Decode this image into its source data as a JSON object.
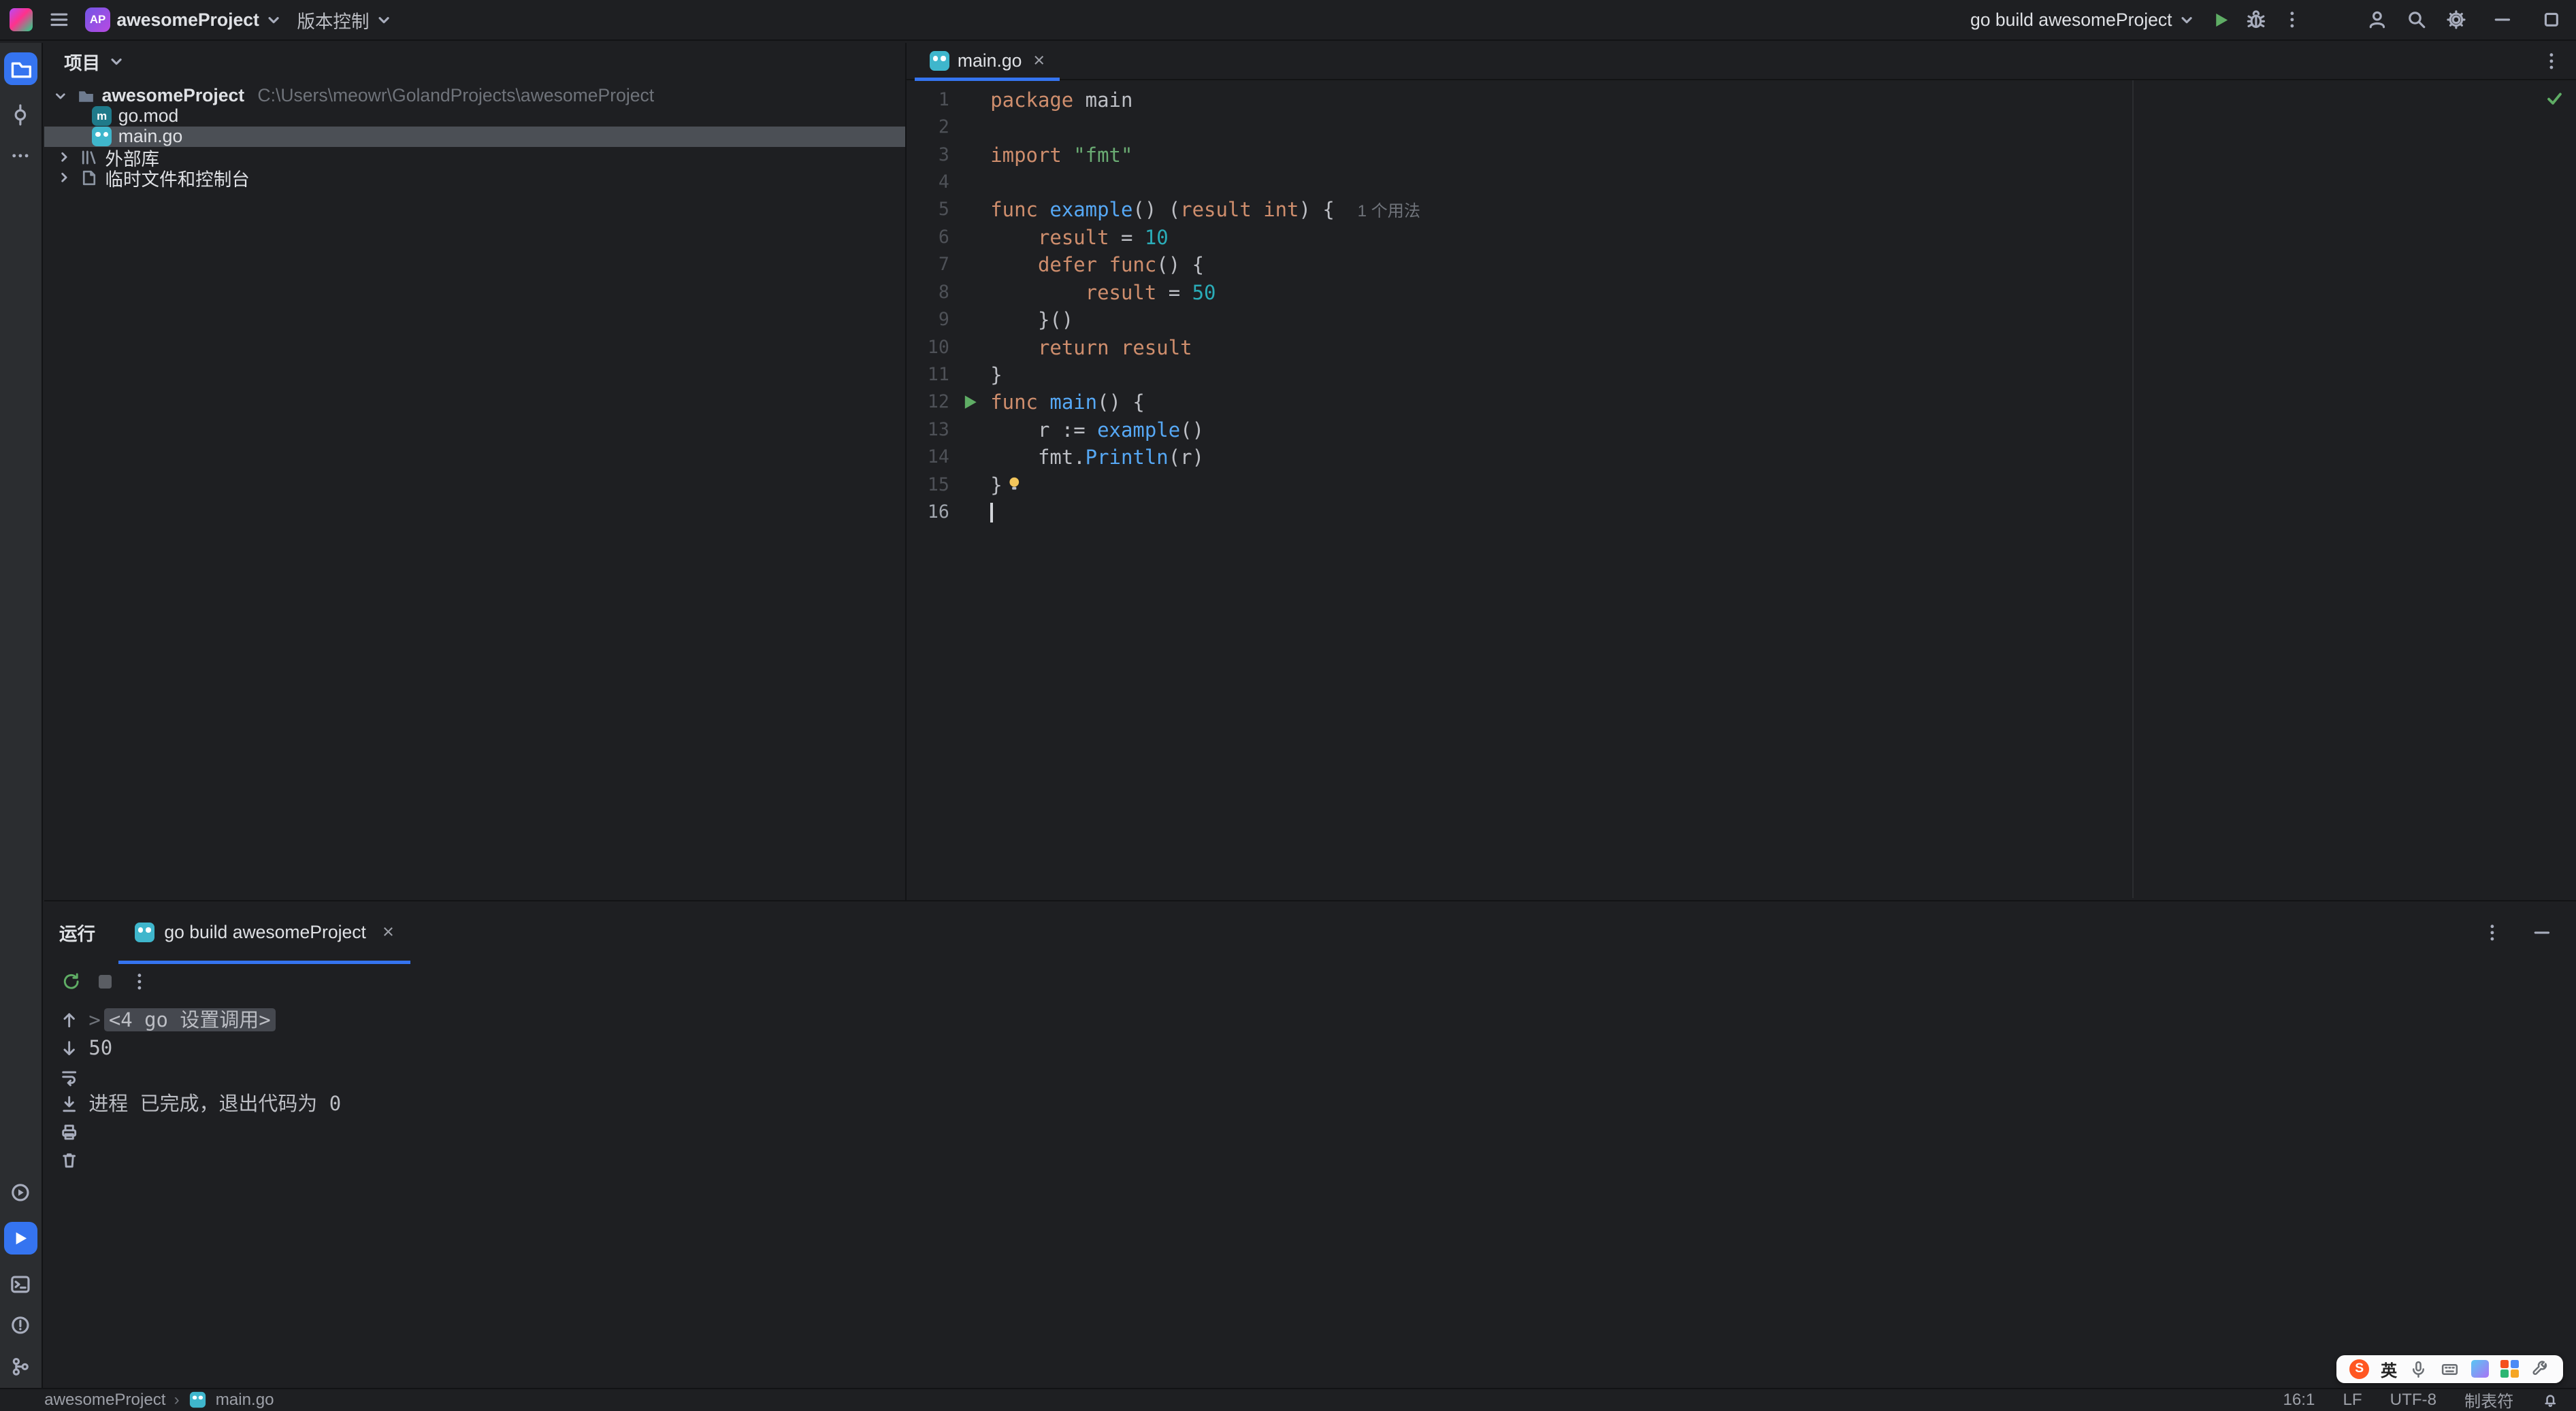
{
  "titlebar": {
    "project_badge": "AP",
    "project_name": "awesomeProject",
    "vcs_label": "版本控制",
    "run_config": "go build awesomeProject"
  },
  "project_panel": {
    "title": "项目",
    "root_name": "awesomeProject",
    "root_path": "C:\\Users\\meowr\\GolandProjects\\awesomeProject",
    "files": [
      "go.mod",
      "main.go"
    ],
    "selected_file": "main.go",
    "external_libraries": "外部库",
    "scratches": "临时文件和控制台"
  },
  "editor": {
    "tab_title": "main.go",
    "caret_line": 16,
    "run_line": 12,
    "bulb_line": 15,
    "hint_line": 5,
    "hint": "1 个用法",
    "lines": [
      [
        [
          "kw",
          "package"
        ],
        [
          "pl",
          " main"
        ]
      ],
      [],
      [
        [
          "kw",
          "import"
        ],
        [
          "pl",
          " "
        ],
        [
          "str",
          "\"fmt\""
        ]
      ],
      [],
      [
        [
          "kw",
          "func"
        ],
        [
          "pl",
          " "
        ],
        [
          "fn",
          "example"
        ],
        [
          "pl",
          "() ("
        ],
        [
          "param",
          "result"
        ],
        [
          "pl",
          " "
        ],
        [
          "kw",
          "int"
        ],
        [
          "pl",
          ") {"
        ]
      ],
      [
        [
          "pl",
          "    "
        ],
        [
          "param",
          "result"
        ],
        [
          "pl",
          " = "
        ],
        [
          "num",
          "10"
        ]
      ],
      [
        [
          "pl",
          "    "
        ],
        [
          "kw",
          "defer"
        ],
        [
          "pl",
          " "
        ],
        [
          "kw",
          "func"
        ],
        [
          "pl",
          "() {"
        ]
      ],
      [
        [
          "pl",
          "        "
        ],
        [
          "param",
          "result"
        ],
        [
          "pl",
          " = "
        ],
        [
          "num",
          "50"
        ]
      ],
      [
        [
          "pl",
          "    }()"
        ]
      ],
      [
        [
          "pl",
          "    "
        ],
        [
          "kw",
          "return"
        ],
        [
          "pl",
          " "
        ],
        [
          "param",
          "result"
        ]
      ],
      [
        [
          "pl",
          "}"
        ]
      ],
      [
        [
          "kw",
          "func"
        ],
        [
          "pl",
          " "
        ],
        [
          "fn",
          "main"
        ],
        [
          "pl",
          "() {"
        ]
      ],
      [
        [
          "pl",
          "    r := "
        ],
        [
          "fn",
          "example"
        ],
        [
          "pl",
          "()"
        ]
      ],
      [
        [
          "pl",
          "    fmt."
        ],
        [
          "fn",
          "Println"
        ],
        [
          "pl",
          "(r)"
        ]
      ],
      [
        [
          "pl",
          "}"
        ]
      ],
      []
    ]
  },
  "run_panel": {
    "title": "运行",
    "tab_title": "go build awesomeProject",
    "console": [
      {
        "type": "fold",
        "text": "<4 go 设置调用>"
      },
      {
        "type": "text",
        "text": "50"
      },
      {
        "type": "blank",
        "text": ""
      },
      {
        "type": "text",
        "text": "进程 已完成，退出代码为 0"
      }
    ]
  },
  "statusbar": {
    "nav_project": "awesomeProject",
    "nav_file": "main.go",
    "caret_position": "16:1",
    "line_separator": "LF",
    "encoding": "UTF-8",
    "indent": "制表符"
  },
  "ime": {
    "brand": "S",
    "lang": "英"
  },
  "colors": {
    "accent_blue": "#3574F0",
    "run_green": "#5FAD65",
    "keyword": "#CF8E6D",
    "string": "#6AAB73",
    "number": "#2AACB8",
    "function": "#56A8F5"
  }
}
